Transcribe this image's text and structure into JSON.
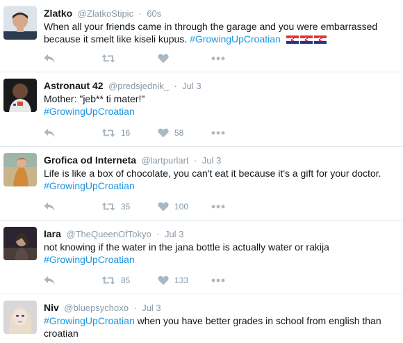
{
  "feed": {
    "tweets": [
      {
        "name": "Zlatko",
        "handle": "@ZlatkoStipic",
        "separator": "·",
        "time": "60s",
        "text": "When all your friends came in through the garage and you were embarrassed because it smelt like kiseli kupus.",
        "hashtag": "#GrowingUpCroatian",
        "retweets": "",
        "likes": ""
      },
      {
        "name": "Astronaut 42",
        "handle": "@predsjednik_",
        "separator": "·",
        "time": "Jul 3",
        "text": "Mother: \"jeb** ti mater!\"",
        "hashtag": "#GrowingUpCroatian",
        "retweets": "16",
        "likes": "58"
      },
      {
        "name": "Grofica od Interneta",
        "handle": "@lartpurlart",
        "separator": "·",
        "time": "Jul 3",
        "text": "Life is like a box of chocolate, you can't eat it because it's a gift for your doctor.",
        "hashtag": "#GrowingUpCroatian",
        "retweets": "35",
        "likes": "100"
      },
      {
        "name": "Iara",
        "handle": "@TheQueenOfTokyo",
        "separator": "·",
        "time": "Jul 3",
        "text": "not knowing if the water in the jana bottle is actually water or rakija",
        "hashtag": "#GrowingUpCroatian",
        "retweets": "85",
        "likes": "133"
      },
      {
        "name": "Niv",
        "handle": "@bluepsychoxo",
        "separator": "·",
        "time": "Jul 3",
        "hashtag": "#GrowingUpCroatian",
        "text": "when you have better grades in school from english than croatian"
      }
    ]
  },
  "colors": {
    "link": "#1b95e0",
    "muted": "#8899a6",
    "icon": "#aab8c2",
    "divider": "#e1e8ed"
  },
  "icons": {
    "reply": "reply-icon",
    "retweet": "retweet-icon",
    "like": "heart-icon",
    "more": "more-icon",
    "flag": "croatia-flag-icon"
  }
}
